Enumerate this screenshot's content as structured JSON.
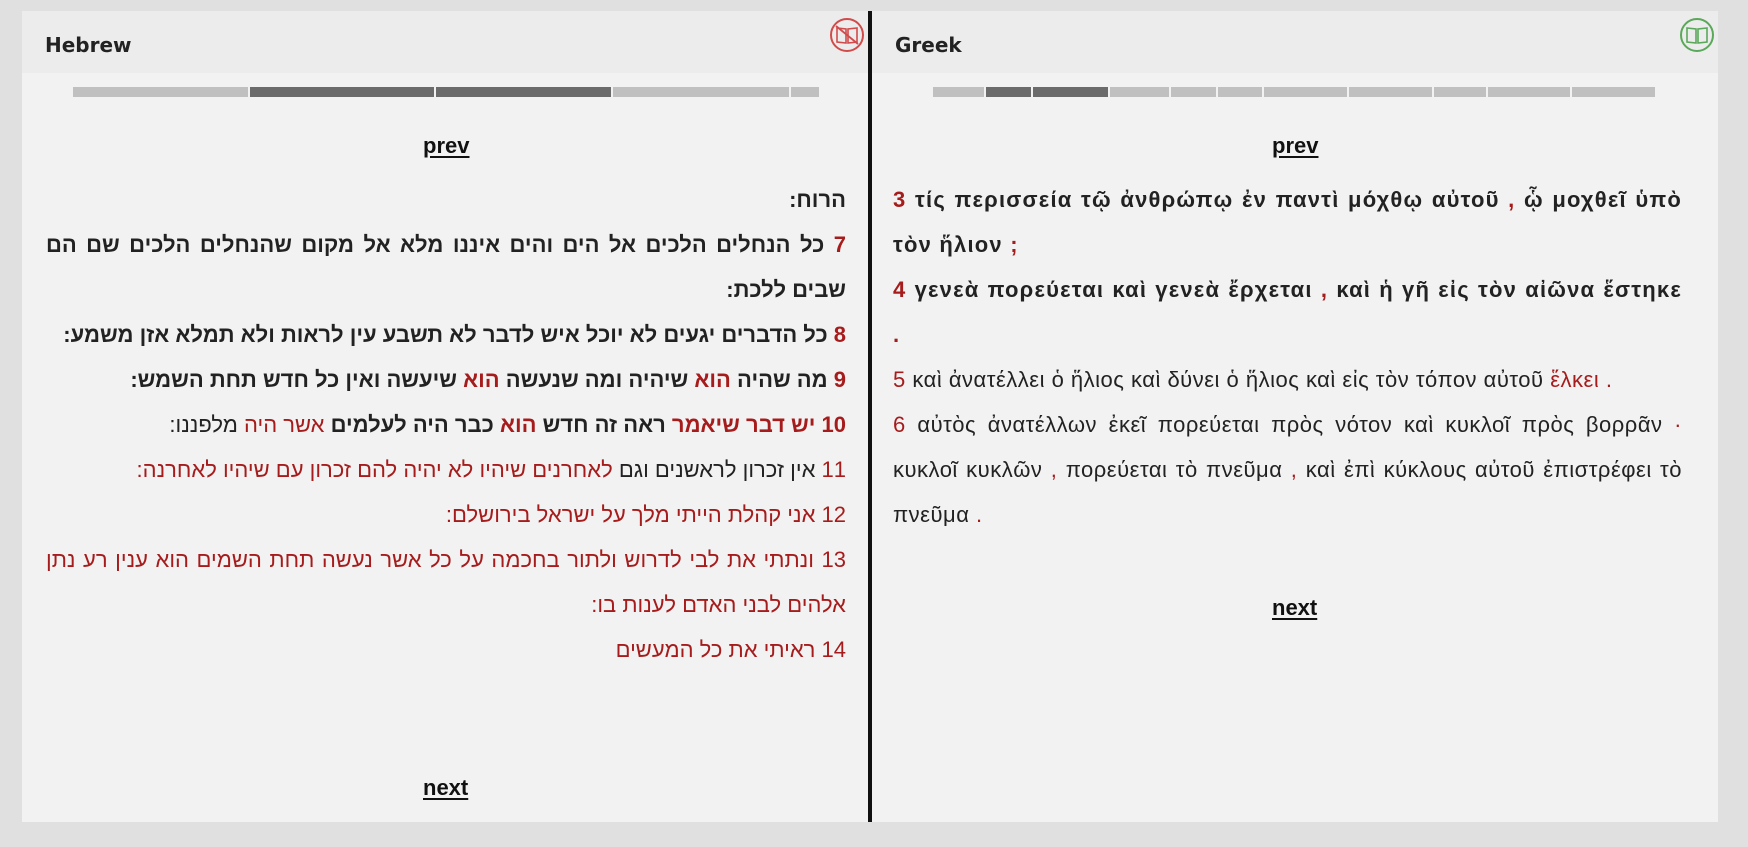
{
  "hebrew": {
    "title": "Hebrew",
    "prev": "prev",
    "next": "next",
    "v6_tail": "הרוח:",
    "v7": {
      "num": "7",
      "text": "כל הנחלים הלכים אל הים והים איננו מלא אל מקום שהנחלים הלכים שם הם שבים ללכת:"
    },
    "v8": {
      "num": "8",
      "text": "כל הדברים יגעים לא יוכל איש לדבר לא תשבע עין לראות ולא תמלא אזן משמע:"
    },
    "v9": {
      "num": "9",
      "a": "מה שהיה",
      "b": "הוא",
      "c": "שיהיה ומה שנעשה",
      "d": "הוא",
      "e": "שיעשה ואין כל חדש תחת השמש:"
    },
    "v10": {
      "num": "10",
      "a": "יש דבר שיאמר",
      "b": "ראה זה חדש",
      "c": "הוא",
      "d": "כבר היה לעלמים",
      "e": "אשר היה",
      "f": "מלפננו:"
    },
    "v11": {
      "num": "11",
      "a": "אין זכרון לראשנים וגם",
      "b": "לאחרנים שיהיו לא יהיה להם זכרון עם שיהיו לאחרנה:"
    },
    "v12": {
      "num": "12",
      "text": "אני קהלת הייתי מלך על ישראל בירושלם:"
    },
    "v13": {
      "num": "13",
      "text": "ונתתי את לבי לדרוש ולתור בחכמה על כל אשר נעשה תחת השמים הוא ענין רע נתן אלהים לבני האדם לענות בו:"
    },
    "v14": {
      "num": "14",
      "text": "ראיתי את כל המעשים"
    }
  },
  "greek": {
    "title": "Greek",
    "prev": "prev",
    "next": "next",
    "v3": {
      "num": "3",
      "a": "τίς περισσεία τῷ ἀνθρώπῳ ἐν παντὶ μόχθῳ αὐτοῦ",
      "p1": ",",
      "b": "ᾧ μοχθεῖ ὑπὸ τὸν ἥλιον",
      "p2": ";"
    },
    "v4": {
      "num": "4",
      "a": "γενεὰ πορεύεται καὶ γενεὰ ἔρχεται",
      "p1": ",",
      "b": "καὶ ἡ γῆ εἰς τὸν αἰῶνα ἕστηκε",
      "p2": "."
    },
    "v5": {
      "num": "5",
      "a": "καὶ ἀνατέλλει ὁ ἥλιος καὶ δύνει ὁ ἥλιος καὶ εἰς τὸν τόπον αὐτοῦ",
      "b": "ἕλκει",
      "p1": "."
    },
    "v6": {
      "num": "6",
      "a": "αὐτὸς ἀνατέλλων ἐκεῖ πορεύεται πρὸς νότον καὶ κυκλοῖ πρὸς βορρᾶν",
      "p1": "·",
      "b": "κυκλοῖ κυκλῶν",
      "p2": ",",
      "c": "πορεύεται τὸ πνεῦμα",
      "p3": ",",
      "d": "καὶ ἐπὶ κύκλους αὐτοῦ ἐπιστρέφει τὸ πνεῦμα",
      "p4": "."
    }
  },
  "colors": {
    "accent": "#a61c1c",
    "divider": "#111111",
    "progress_active": "#6b6b6b",
    "progress": "#c0c0c0"
  },
  "icons": {
    "hebrew": "book-disabled-icon",
    "greek": "book-icon"
  }
}
